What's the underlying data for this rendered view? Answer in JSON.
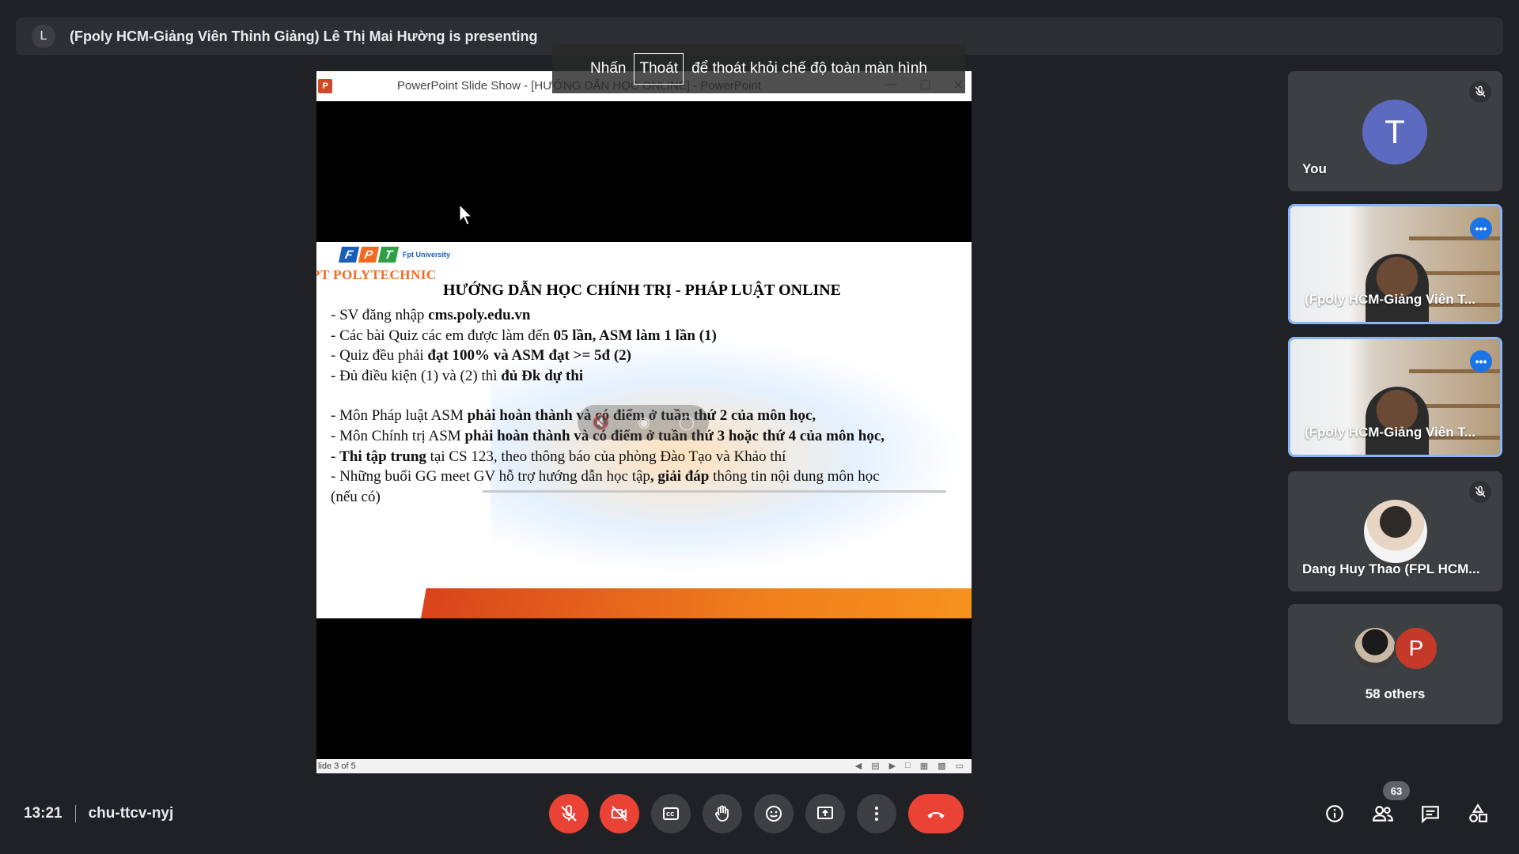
{
  "banner": {
    "avatar_letter": "L",
    "presenting_text": "(Fpoly HCM-Giảng Viên Thỉnh Giảng) Lê Thị Mai Hường is presenting"
  },
  "fullscreen_hint": {
    "before": "Nhấn",
    "key": "Thoát",
    "after": "để thoát khỏi chế độ toàn màn hình"
  },
  "powerpoint": {
    "window_title": "PowerPoint Slide Show - [HƯỚNG DẪN HỌC ONLINE] - PowerPoint",
    "status": "lide 3 of 5"
  },
  "slide": {
    "fpt_letters": [
      "F",
      "P",
      "T"
    ],
    "fpt_colors": [
      "#1a5fb4",
      "#f26a1f",
      "#2f9e44"
    ],
    "fpt_sub": "Fpt University",
    "poly_name": "PT POLYTECHNIC",
    "heading": "HƯỚNG DẪN HỌC CHÍNH TRỊ - PHÁP LUẬT ONLINE",
    "lines": [
      {
        "pre": "-   SV đăng nhập ",
        "bold": "cms.poly.edu.vn",
        "post": ""
      },
      {
        "pre": "- Các bài Quiz các em được làm đến ",
        "bold": "05 lần, ASM làm 1 lần (1)",
        "post": ""
      },
      {
        "pre": "-  Quiz đều phải ",
        "bold": "đạt 100% và ASM đạt >= 5đ (2)",
        "post": ""
      },
      {
        "pre": "-  Đủ điều kiện (1) và  (2) thì ",
        "bold": "đủ Đk dự thi",
        "post": ""
      },
      {
        "pre": "",
        "bold": "",
        "post": ""
      },
      {
        "pre": "-   Môn Pháp luật ASM ",
        "bold": "phải hoàn thành và có điểm ở tuần thứ 2 của môn học,",
        "post": ""
      },
      {
        "pre": "-   Môn Chính trị ASM ",
        "bold": "phải hoàn thành và có điểm ở tuần thứ 3 hoặc thứ 4 của môn học,",
        "post": ""
      },
      {
        "pre": "-  ",
        "bold": "Thi tập trung",
        "post": " tại CS 123, theo thông báo của phòng Đào Tạo và Khảo thí"
      },
      {
        "pre": "-  Những buổi GG meet GV hỗ trợ hướng dẫn học tập",
        "bold": ", giải đáp",
        "post": " thông tin nội dung môn học"
      },
      {
        "pre": "   (nếu có)",
        "bold": "",
        "post": ""
      }
    ]
  },
  "participants": {
    "you": {
      "letter": "T",
      "name": "You"
    },
    "presenter_1": {
      "name": "(Fpoly HCM-Giảng Viên T..."
    },
    "presenter_2": {
      "name": "(Fpoly HCM-Giảng Viên T..."
    },
    "dang": {
      "name": "Dang Huy Thao (FPL HCM..."
    },
    "others": {
      "letter": "P",
      "label": "58 others"
    }
  },
  "footer": {
    "time": "13:21",
    "meeting_code": "chu-ttcv-nyj",
    "people_count": "63"
  },
  "colors": {
    "background": "#202124",
    "tile": "#3c4043",
    "danger": "#ea4335",
    "accent": "#8ab4f8"
  }
}
